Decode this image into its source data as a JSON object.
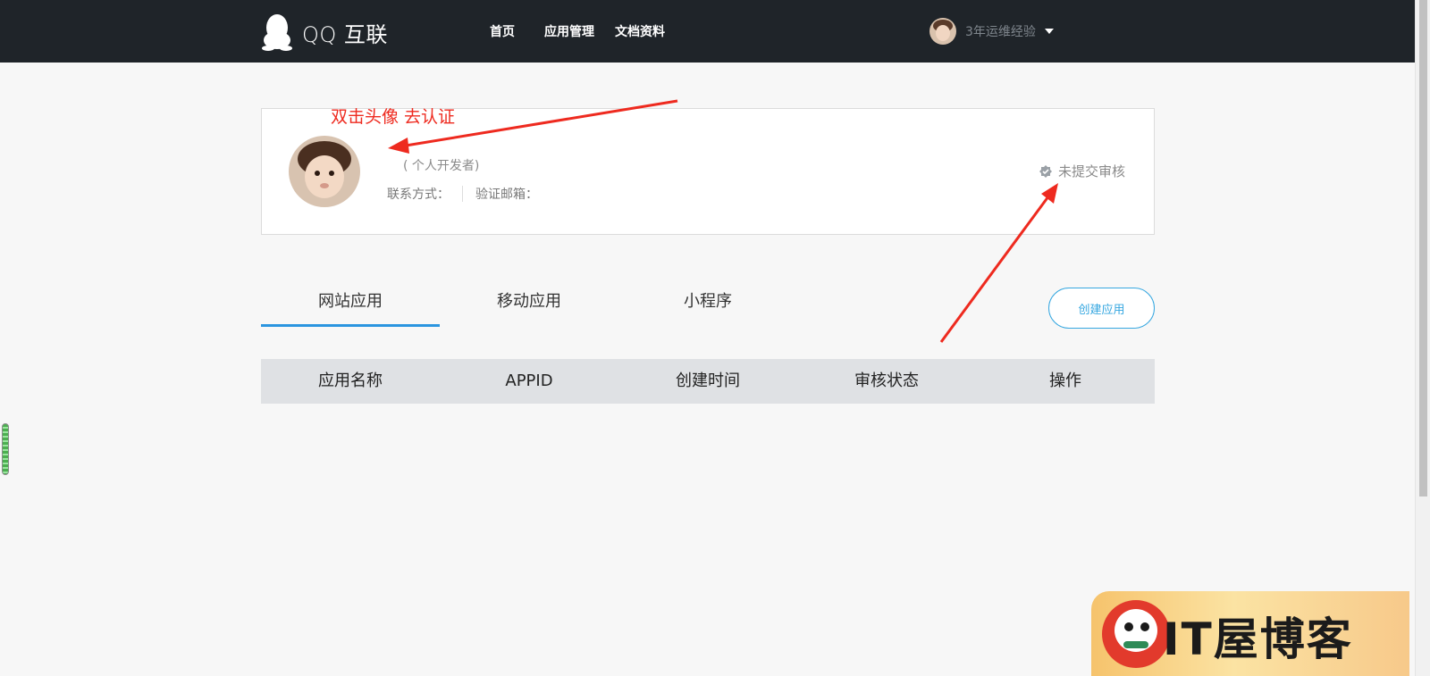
{
  "header": {
    "logo_text": "QQ 互联",
    "nav": [
      "首页",
      "应用管理",
      "文档资料"
    ],
    "user_name": "3年运维经验"
  },
  "profile": {
    "annotation": "双击头像 去认证",
    "developer_type": "( 个人开发者)",
    "contact_label": "联系方式：",
    "email_label": "验证邮箱：",
    "status_text": "未提交审核"
  },
  "tabs": [
    "网站应用",
    "移动应用",
    "小程序"
  ],
  "active_tab": "网站应用",
  "create_button": "创建应用",
  "table": {
    "headers": [
      "应用名称",
      "APPID",
      "创建时间",
      "审核状态",
      "操作"
    ]
  },
  "watermark": {
    "text": "IT屋博客"
  },
  "colors": {
    "nav_bg": "#1f2429",
    "accent": "#2b95df",
    "annotation_red": "#ee2a1f"
  }
}
